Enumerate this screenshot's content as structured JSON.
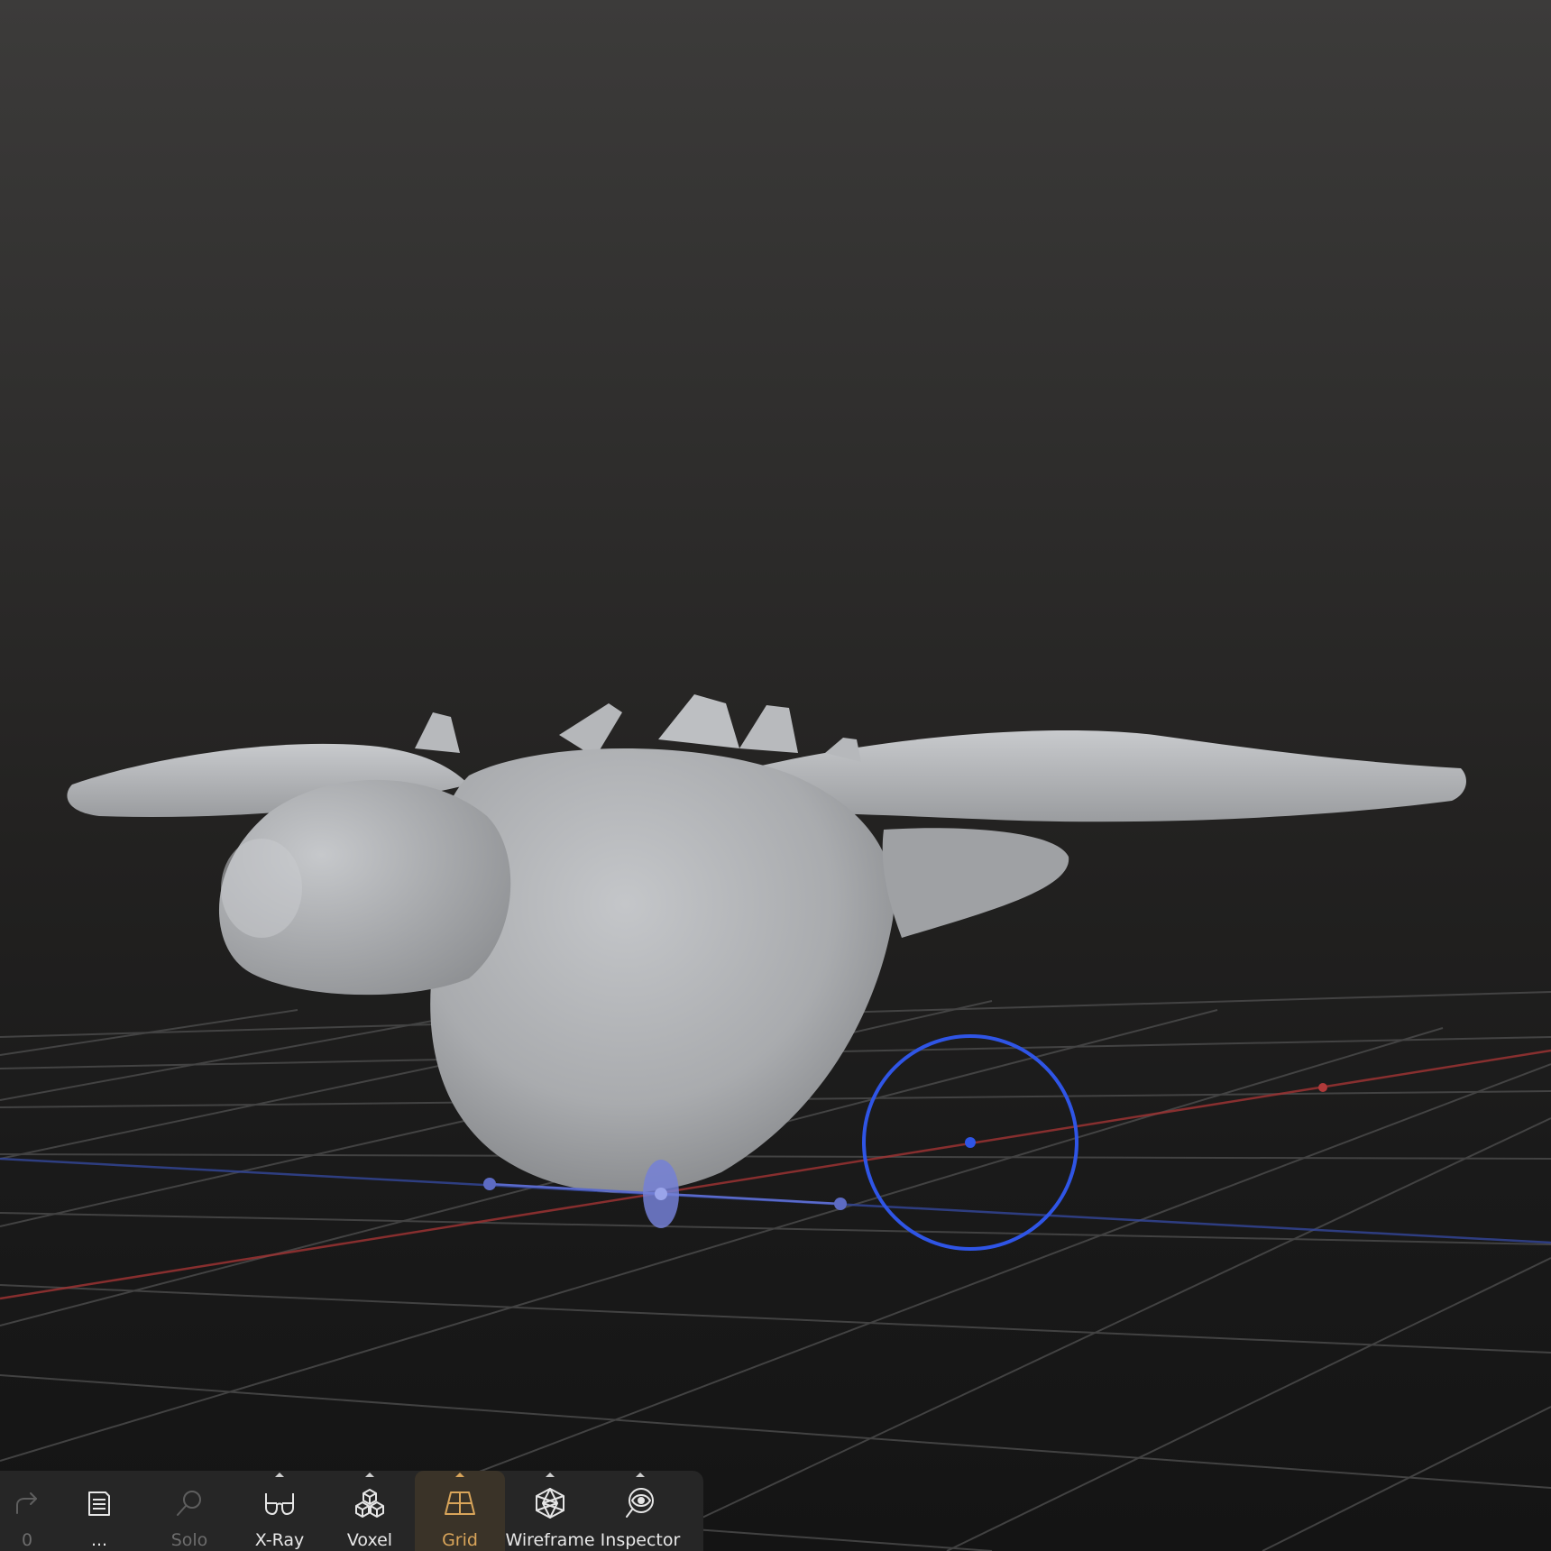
{
  "viewport": {
    "background_top": "#3c3b3a",
    "background_bottom": "#141414",
    "grid_color": "#5a5a5a",
    "axis_x_color": "#b03a3a",
    "axis_z_color": "#3a4fa8",
    "mesh_color": "#b9bbbe",
    "gizmo_color": "#2f55e6"
  },
  "toolbar": {
    "accent_color": "#d9a55a",
    "items": [
      {
        "id": "redo",
        "label": "0",
        "icon": "redo-icon",
        "disabled": true,
        "active": false,
        "has_menu": false
      },
      {
        "id": "scene",
        "label": "...",
        "icon": "document-icon",
        "disabled": false,
        "active": false,
        "has_menu": false
      },
      {
        "id": "solo",
        "label": "Solo",
        "icon": "search-icon",
        "disabled": true,
        "active": false,
        "has_menu": false
      },
      {
        "id": "xray",
        "label": "X-Ray",
        "icon": "glasses-icon",
        "disabled": false,
        "active": false,
        "has_menu": true
      },
      {
        "id": "voxel",
        "label": "Voxel",
        "icon": "cubes-icon",
        "disabled": false,
        "active": false,
        "has_menu": true
      },
      {
        "id": "grid",
        "label": "Grid",
        "icon": "grid-plane-icon",
        "disabled": false,
        "active": true,
        "has_menu": true
      },
      {
        "id": "wireframe",
        "label": "Wireframe",
        "icon": "wireframe-sphere-icon",
        "disabled": false,
        "active": false,
        "has_menu": true
      },
      {
        "id": "inspector",
        "label": "Inspector",
        "icon": "eye-magnifier-icon",
        "disabled": false,
        "active": false,
        "has_menu": true
      }
    ]
  }
}
